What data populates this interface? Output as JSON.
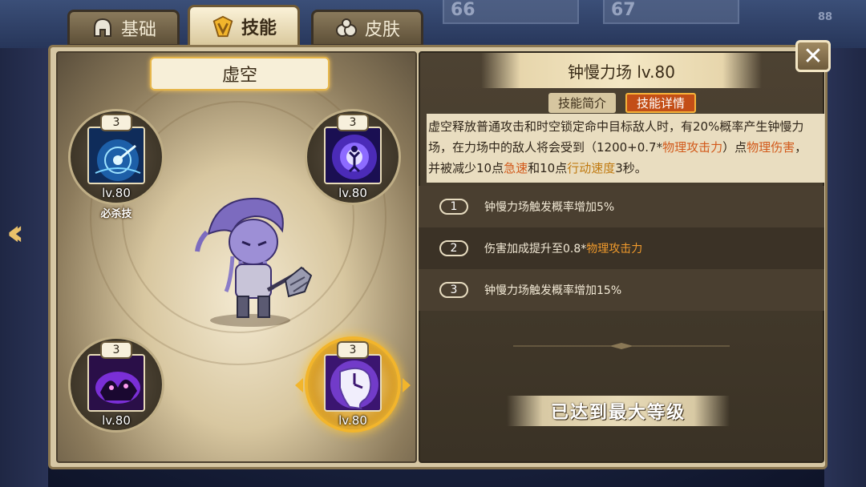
{
  "background": {
    "cards": [
      "66",
      "67"
    ],
    "side_badge": "88"
  },
  "tabs": [
    {
      "label": "基础",
      "icon": "helmet-icon",
      "active": false
    },
    {
      "label": "技能",
      "icon": "skill-crest-icon",
      "active": true
    },
    {
      "label": "皮肤",
      "icon": "clothes-icon",
      "active": false
    }
  ],
  "hero": {
    "name": "虚空"
  },
  "skills": [
    {
      "count": "3",
      "level": "lv.80",
      "tag": "必杀技",
      "icon": "radar-vortex-icon"
    },
    {
      "count": "3",
      "level": "lv.80",
      "tag": "",
      "icon": "spiral-figure-icon"
    },
    {
      "count": "3",
      "level": "lv.80",
      "tag": "",
      "icon": "shadow-beast-icon"
    },
    {
      "count": "3",
      "level": "lv.80",
      "tag": "",
      "icon": "melting-clock-icon",
      "selected": true
    }
  ],
  "detail": {
    "title": "钟慢力场 lv.80",
    "subtabs": {
      "intro": "技能简介",
      "detail": "技能详情"
    },
    "description": {
      "p1": "虚空释放普通攻击和时空锁定命中目标敌人时，有20%概率产生钟慢力场，在力场中的敌人将会受到（1200+0.7*",
      "h1": "物理攻击力",
      "p2": "）点",
      "h2": "物理伤害",
      "p3": "，并被减少10点",
      "h3": "急速",
      "p4": "和10点",
      "h4": "行动速度",
      "p5": "3秒。"
    },
    "upgrades": [
      {
        "num": "1",
        "text": "钟慢力场触发概率增加5%",
        "highlight": ""
      },
      {
        "num": "2",
        "text": "伤害加成提升至0.8*",
        "highlight": "物理攻击力"
      },
      {
        "num": "3",
        "text": "钟慢力场触发概率增加15%",
        "highlight": ""
      }
    ],
    "max_level": "已达到最大等级"
  },
  "colors": {
    "accent_gold": "#f2b52c",
    "highlight_orange": "#d2591a",
    "active_subtab": "#c34e17"
  }
}
